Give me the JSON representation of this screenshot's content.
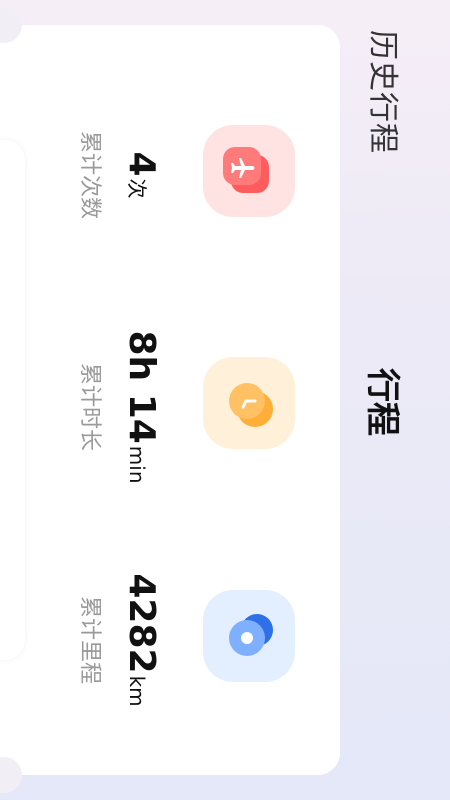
{
  "header": {
    "history_label": "历史行程",
    "title": "行程"
  },
  "stats": [
    {
      "icon": "airplane-icon",
      "value": "4",
      "unit": "次",
      "label": "累计次数",
      "color": "#ff6b6b"
    },
    {
      "icon": "clock-icon",
      "value": "8h 14",
      "unit": "min",
      "label": "累计时长",
      "color": "#ffb347"
    },
    {
      "icon": "location-icon",
      "value": "4282",
      "unit": "km",
      "label": "累计里程",
      "color": "#4f8cf0"
    }
  ]
}
